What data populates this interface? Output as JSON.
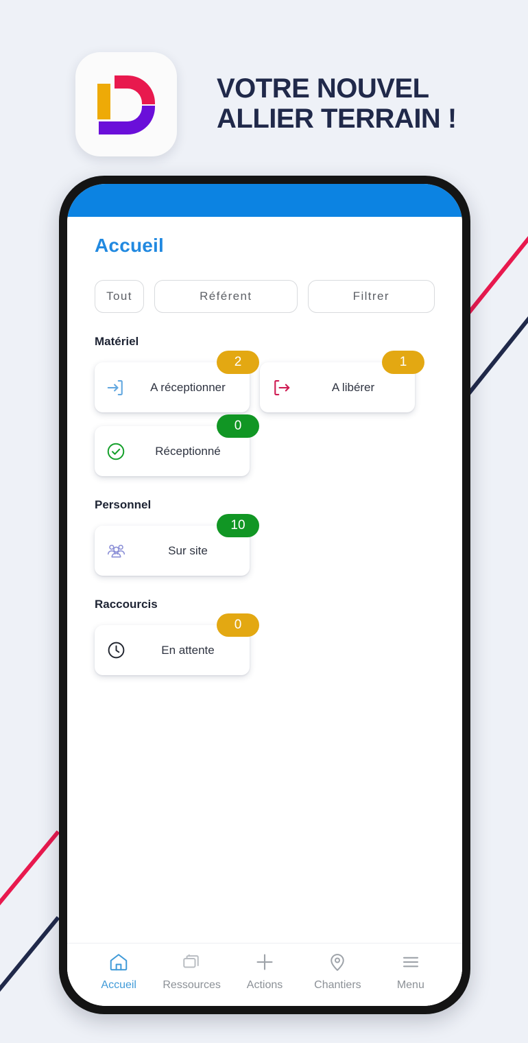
{
  "background_color": "#eef1f7",
  "hero": {
    "logo": {
      "icon": "dynamic-d-logo-icon",
      "tile_color": "#fbfbfb",
      "bar_color": "#eeaa07",
      "upper_arc_color": "#e8194e",
      "lower_arc_color": "#6a0fd9"
    },
    "headline_line1": "VOTRE NOUVEL",
    "headline_line2": "ALLIER TERRAIN !",
    "headline_color": "#20294a"
  },
  "decor": {
    "crimson": "#e8194e",
    "navy": "#20294a"
  },
  "phone": {
    "bezel_color": "#141414",
    "status_bar_color": "#0c83e2",
    "app": {
      "page_title": "Accueil",
      "page_title_color": "#2189e0",
      "filters": [
        {
          "label": "Tout",
          "name": "filter-chip-tout"
        },
        {
          "label": "Référent",
          "name": "filter-chip-referent"
        },
        {
          "label": "Filtrer",
          "name": "filter-chip-filtrer"
        }
      ],
      "sections": [
        {
          "label": "Matériel",
          "rows": [
            [
              {
                "label": "A réceptionner",
                "count": "2",
                "badge_color": "#e3a812",
                "icon": "login-arrow-icon",
                "icon_color": "#63a8e0"
              },
              {
                "label": "A libérer",
                "count": "1",
                "badge_color": "#e3a812",
                "icon": "logout-arrow-icon",
                "icon_color": "#cf1c53"
              }
            ],
            [
              {
                "label": "Réceptionné",
                "count": "0",
                "badge_color": "#119624",
                "icon": "check-circle-icon",
                "icon_color": "#15a02b"
              }
            ]
          ]
        },
        {
          "label": "Personnel",
          "rows": [
            [
              {
                "label": "Sur site",
                "count": "10",
                "badge_color": "#119624",
                "icon": "people-group-icon",
                "icon_color": "#8a8ed6"
              }
            ]
          ]
        },
        {
          "label": "Raccourcis",
          "rows": [
            [
              {
                "label": "En attente",
                "count": "0",
                "badge_color": "#e3a812",
                "icon": "clock-icon",
                "icon_color": "#20242e"
              }
            ]
          ]
        }
      ],
      "tabbar": {
        "active_color": "#3f9ad8",
        "inactive_color": "#8b9096",
        "items": [
          {
            "label": "Accueil",
            "icon": "home-icon",
            "active": true
          },
          {
            "label": "Ressources",
            "icon": "cards-stack-icon",
            "active": false
          },
          {
            "label": "Actions",
            "icon": "plus-icon",
            "active": false
          },
          {
            "label": "Chantiers",
            "icon": "map-pin-icon",
            "active": false
          },
          {
            "label": "Menu",
            "icon": "hamburger-icon",
            "active": false
          }
        ]
      }
    }
  }
}
